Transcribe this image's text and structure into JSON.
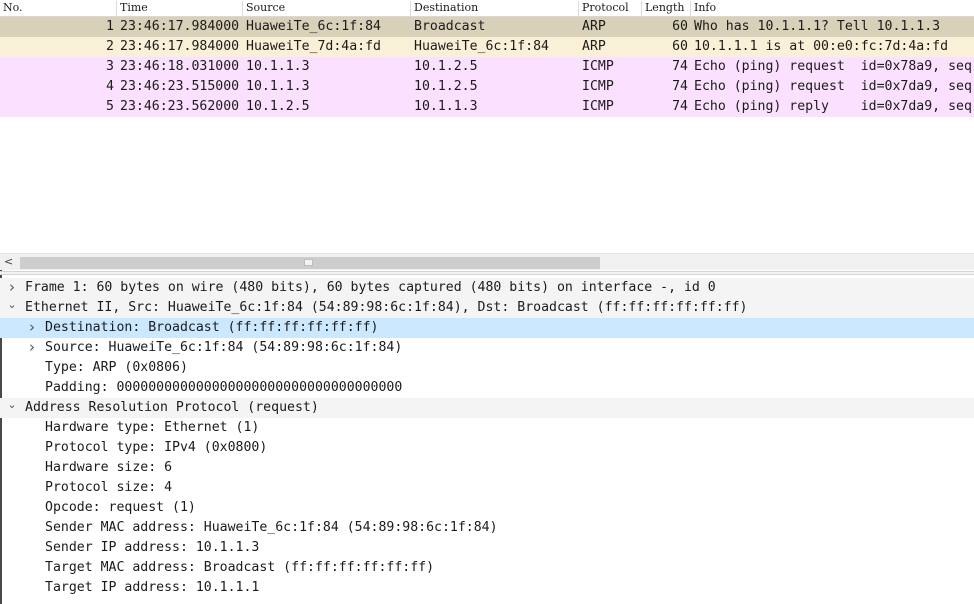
{
  "columns": [
    "No.",
    "Time",
    "Source",
    "Destination",
    "Protocol",
    "Length",
    "Info"
  ],
  "packets": [
    {
      "no": "1",
      "time": "23:46:17.984000",
      "source": "HuaweiTe_6c:1f:84",
      "destination": "Broadcast",
      "protocol": "ARP",
      "length": "60",
      "info": "Who has 10.1.1.1? Tell 10.1.1.3"
    },
    {
      "no": "2",
      "time": "23:46:17.984000",
      "source": "HuaweiTe_7d:4a:fd",
      "destination": "HuaweiTe_6c:1f:84",
      "protocol": "ARP",
      "length": "60",
      "info": "10.1.1.1 is at 00:e0:fc:7d:4a:fd"
    },
    {
      "no": "3",
      "time": "23:46:18.031000",
      "source": "10.1.1.3",
      "destination": "10.1.2.5",
      "protocol": "ICMP",
      "length": "74",
      "info": "Echo (ping) request  id=0x78a9, seq"
    },
    {
      "no": "4",
      "time": "23:46:23.515000",
      "source": "10.1.1.3",
      "destination": "10.1.2.5",
      "protocol": "ICMP",
      "length": "74",
      "info": "Echo (ping) request  id=0x7da9, seq"
    },
    {
      "no": "5",
      "time": "23:46:23.562000",
      "source": "10.1.2.5",
      "destination": "10.1.1.3",
      "protocol": "ICMP",
      "length": "74",
      "info": "Echo (ping) reply    id=0x7da9, seq"
    }
  ],
  "row_colors": {
    "selected_arp": "#d8d0b8",
    "arp": "#faf0d7",
    "icmp": "#fce0ff"
  },
  "scrollbar": {
    "left_arrow": "<"
  },
  "details": [
    {
      "text": "Frame 1: 60 bytes on wire (480 bits), 60 bytes captured (480 bits) on interface -, id 0",
      "expanded": false
    },
    {
      "text": "Ethernet II, Src: HuaweiTe_6c:1f:84 (54:89:98:6c:1f:84), Dst: Broadcast (ff:ff:ff:ff:ff:ff)",
      "expanded": true
    },
    {
      "text": "Destination: Broadcast (ff:ff:ff:ff:ff:ff)",
      "expanded": false,
      "selected": true
    },
    {
      "text": "Source: HuaweiTe_6c:1f:84 (54:89:98:6c:1f:84)",
      "expanded": false
    },
    {
      "text": "Type: ARP (0x0806)"
    },
    {
      "text": "Padding: 000000000000000000000000000000000000"
    },
    {
      "text": "Address Resolution Protocol (request)",
      "expanded": true
    },
    {
      "text": "Hardware type: Ethernet (1)"
    },
    {
      "text": "Protocol type: IPv4 (0x0800)"
    },
    {
      "text": "Hardware size: 6"
    },
    {
      "text": "Protocol size: 4"
    },
    {
      "text": "Opcode: request (1)"
    },
    {
      "text": "Sender MAC address: HuaweiTe_6c:1f:84 (54:89:98:6c:1f:84)"
    },
    {
      "text": "Sender IP address: 10.1.1.3"
    },
    {
      "text": "Target MAC address: Broadcast (ff:ff:ff:ff:ff:ff)"
    },
    {
      "text": "Target IP address: 10.1.1.1"
    }
  ],
  "icons": {
    "collapsed": "chevron-right-icon",
    "expanded": "chevron-down-icon"
  }
}
